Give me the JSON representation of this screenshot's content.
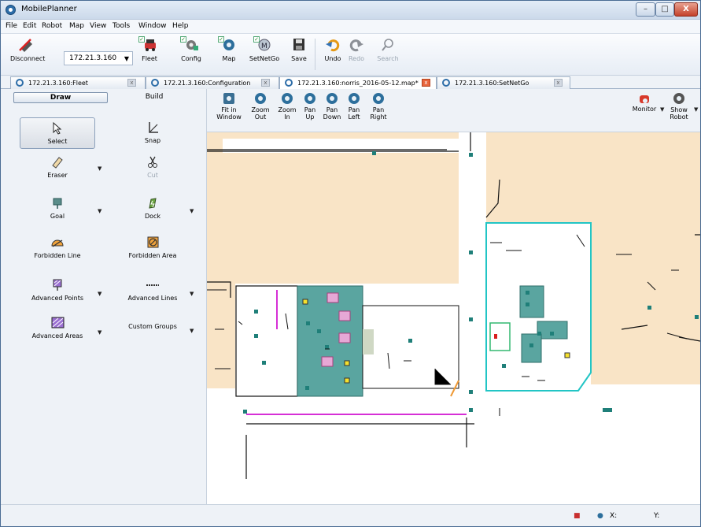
{
  "window": {
    "title": "MobilePlanner",
    "minimize": "–",
    "maximize": "□",
    "close": "X"
  },
  "menu": [
    "File",
    "Edit",
    "Robot",
    "Map",
    "View",
    "Tools",
    "Window",
    "Help"
  ],
  "toolbar": {
    "disconnect": "Disconnect",
    "ip_value": "172.21.3.160",
    "fleet": "Fleet",
    "config": "Config",
    "map": "Map",
    "setnetgo": "SetNetGo",
    "save": "Save",
    "undo": "Undo",
    "redo": "Redo",
    "search": "Search"
  },
  "tabs": [
    {
      "label": "172.21.3.160:Fleet"
    },
    {
      "label": "172.21.3.160:Configuration"
    },
    {
      "label": "172.21.3.160:norris_2016-05-12.map*"
    },
    {
      "label": "172.21.3.160:SetNetGo"
    }
  ],
  "tab_close": "x",
  "left": {
    "draw": "Draw",
    "build": "Build",
    "tools": {
      "select": "Select",
      "snap": "Snap",
      "eraser": "Eraser",
      "cut": "Cut",
      "goal": "Goal",
      "dock": "Dock",
      "forbidden_line": "Forbidden Line",
      "forbidden_area": "Forbidden Area",
      "advanced_points": "Advanced Points",
      "advanced_lines": "Advanced Lines",
      "advanced_areas": "Advanced Areas",
      "custom_groups": "Custom Groups"
    },
    "dropdown": "▼"
  },
  "map_toolbar": {
    "fit1": "Fit in",
    "fit2": "Window",
    "zoomout1": "Zoom",
    "zoomout2": "Out",
    "zoomin1": "Zoom",
    "zoomin2": "In",
    "panup1": "Pan",
    "panup2": "Up",
    "pandown1": "Pan",
    "pandown2": "Down",
    "panleft1": "Pan",
    "panleft2": "Left",
    "panright1": "Pan",
    "panright2": "Right",
    "monitor": "Monitor",
    "show_robot1": "Show",
    "show_robot2": "Robot"
  },
  "status": {
    "x_label": "X:",
    "y_label": "Y:"
  },
  "colors": {
    "floor": "#f9e4c6",
    "goal": "#1f7f79",
    "forbidden_line": "#d62fd6",
    "area": "#5aa5a0",
    "cyan": "#22c5c5",
    "orange": "#ef9a36"
  }
}
